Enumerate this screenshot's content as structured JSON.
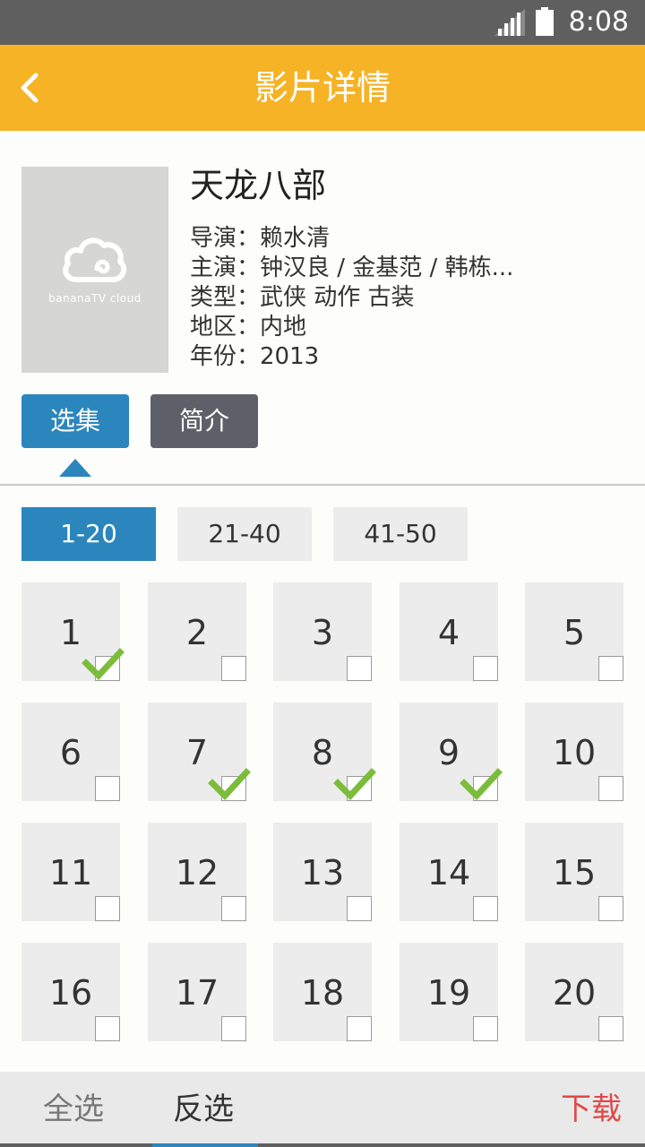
{
  "status_bar": {
    "time": "8:08",
    "icons": [
      "signal-icon",
      "battery-icon"
    ]
  },
  "header": {
    "title": "影片详情",
    "back_icon": "chevron-left-icon"
  },
  "movie": {
    "poster_logo_text": "bananaTV cloud",
    "title": "天龙八部",
    "info": [
      "导演：赖水清",
      "主演：钟汉良 / 金基范 / 韩栋...",
      "类型：武侠 动作 古装",
      "地区：内地",
      "年份：2013"
    ]
  },
  "tabs": {
    "select": "选集",
    "intro": "简介"
  },
  "ranges": [
    "1-20",
    "21-40",
    "41-50"
  ],
  "episodes": [
    "1",
    "2",
    "3",
    "4",
    "5",
    "6",
    "7",
    "8",
    "9",
    "10",
    "11",
    "12",
    "13",
    "14",
    "15",
    "16",
    "17",
    "18",
    "19",
    "20"
  ],
  "checked_episodes": [
    "1",
    "7",
    "8",
    "9"
  ],
  "bottom_bar": {
    "select_all": "全选",
    "invert": "反选",
    "download": "下载"
  },
  "colors": {
    "status_bar": "#5f5f5f",
    "title_bar": "#f5b325",
    "accent_blue": "#2a86bd",
    "tab_gray": "#5e6069",
    "check_green": "#7bbd3a",
    "download_red": "#e04848"
  }
}
